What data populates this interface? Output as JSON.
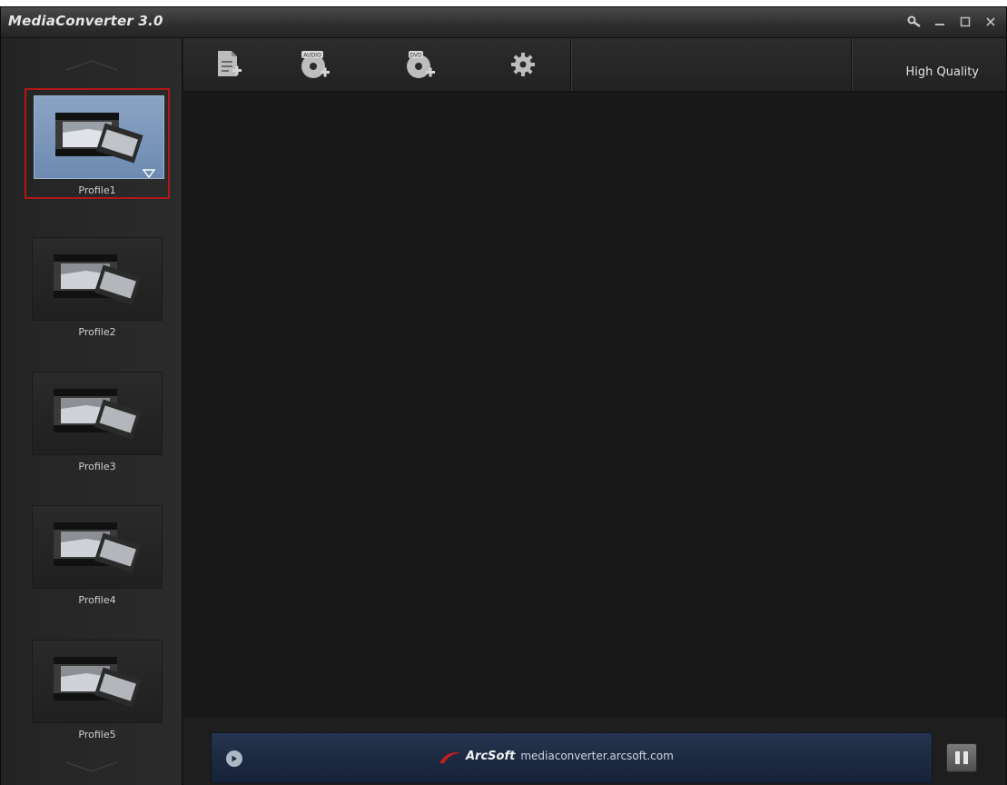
{
  "window": {
    "title": "MediaConverter 3.0"
  },
  "toolbar": {
    "buttons": [
      {
        "name": "add-file-button",
        "icon": "document-add-icon"
      },
      {
        "name": "add-audio-disc-button",
        "icon": "audio-cd-add-icon",
        "badge": "AUDIO"
      },
      {
        "name": "add-dvd-disc-button",
        "icon": "dvd-add-icon",
        "badge": "DVD"
      },
      {
        "name": "settings-button",
        "icon": "gear-icon"
      }
    ],
    "quality_label": "High Quality"
  },
  "profiles": [
    {
      "label": "Profile1",
      "selected": true
    },
    {
      "label": "Profile2",
      "selected": false
    },
    {
      "label": "Profile3",
      "selected": false
    },
    {
      "label": "Profile4",
      "selected": false
    },
    {
      "label": "Profile5",
      "selected": false
    }
  ],
  "bottom": {
    "brand": "ArcSoft",
    "url": "mediaconverter.arcsoft.com"
  },
  "colors": {
    "selected_border": "#b01818",
    "selected_thumb": "#7b97bb",
    "adbar": "#1c2940"
  }
}
